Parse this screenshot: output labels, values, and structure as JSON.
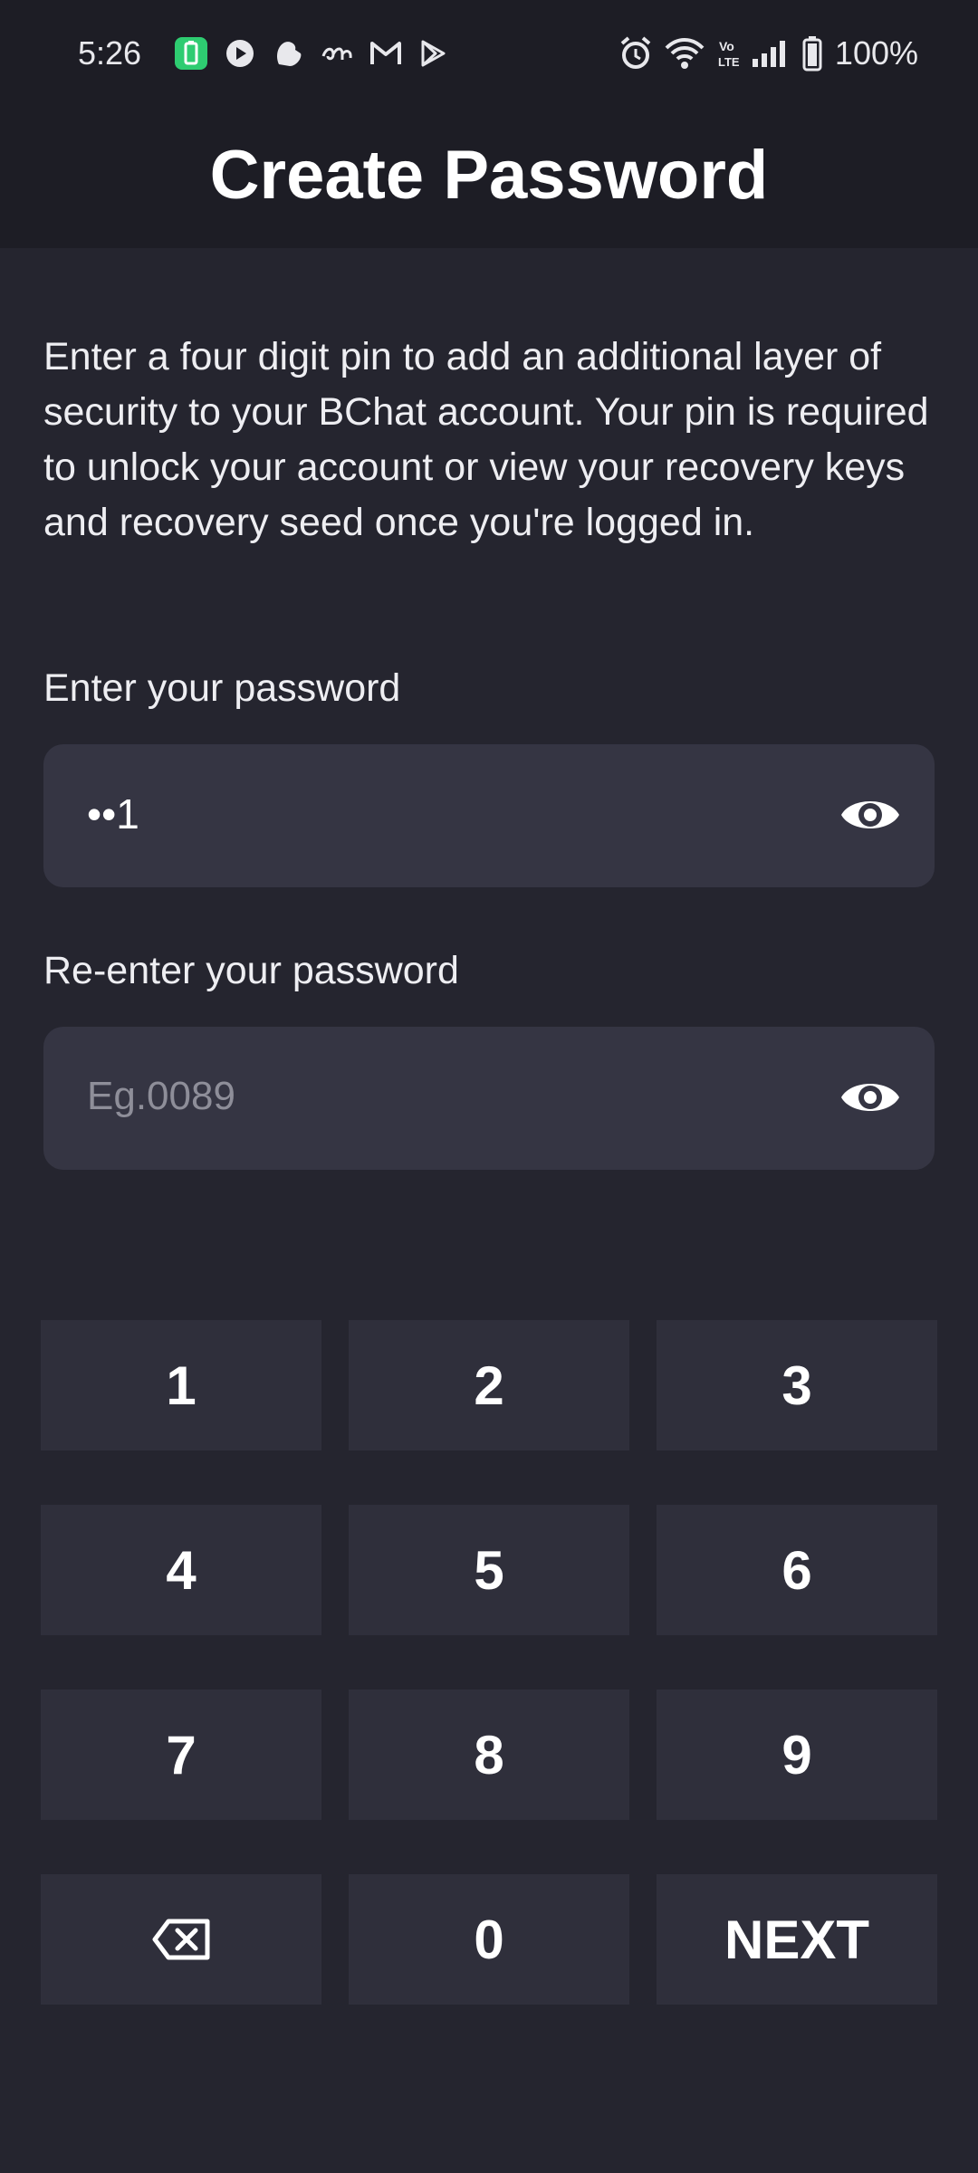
{
  "status_bar": {
    "time": "5:26",
    "battery": "100%",
    "left_icons": [
      "battery-saver-icon",
      "youtube-icon",
      "hand-icon",
      "script-icon",
      "gmail-icon",
      "play-store-icon"
    ],
    "right_icons": [
      "alarm-icon",
      "wifi-icon",
      "volte-icon",
      "signal-icon",
      "battery-icon"
    ]
  },
  "header": {
    "title": "Create Password"
  },
  "description": "Enter a four digit pin to add an additional layer of security to your BChat account. Your pin is required to unlock your account or view your recovery keys and recovery seed once you're logged in.",
  "password_field": {
    "label": "Enter your password",
    "value": "••1"
  },
  "confirm_field": {
    "label": "Re-enter your password",
    "placeholder": "Eg.0089"
  },
  "keypad": {
    "k1": "1",
    "k2": "2",
    "k3": "3",
    "k4": "4",
    "k5": "5",
    "k6": "6",
    "k7": "7",
    "k8": "8",
    "k9": "9",
    "backspace_icon": "backspace-icon",
    "k0": "0",
    "next": "NEXT"
  },
  "colors": {
    "background": "#25252f",
    "header": "#1d1d25",
    "field": "#353543",
    "key": "#2f2f3b",
    "placeholder": "#8e8e99",
    "battery_saver": "#2ecc71"
  }
}
